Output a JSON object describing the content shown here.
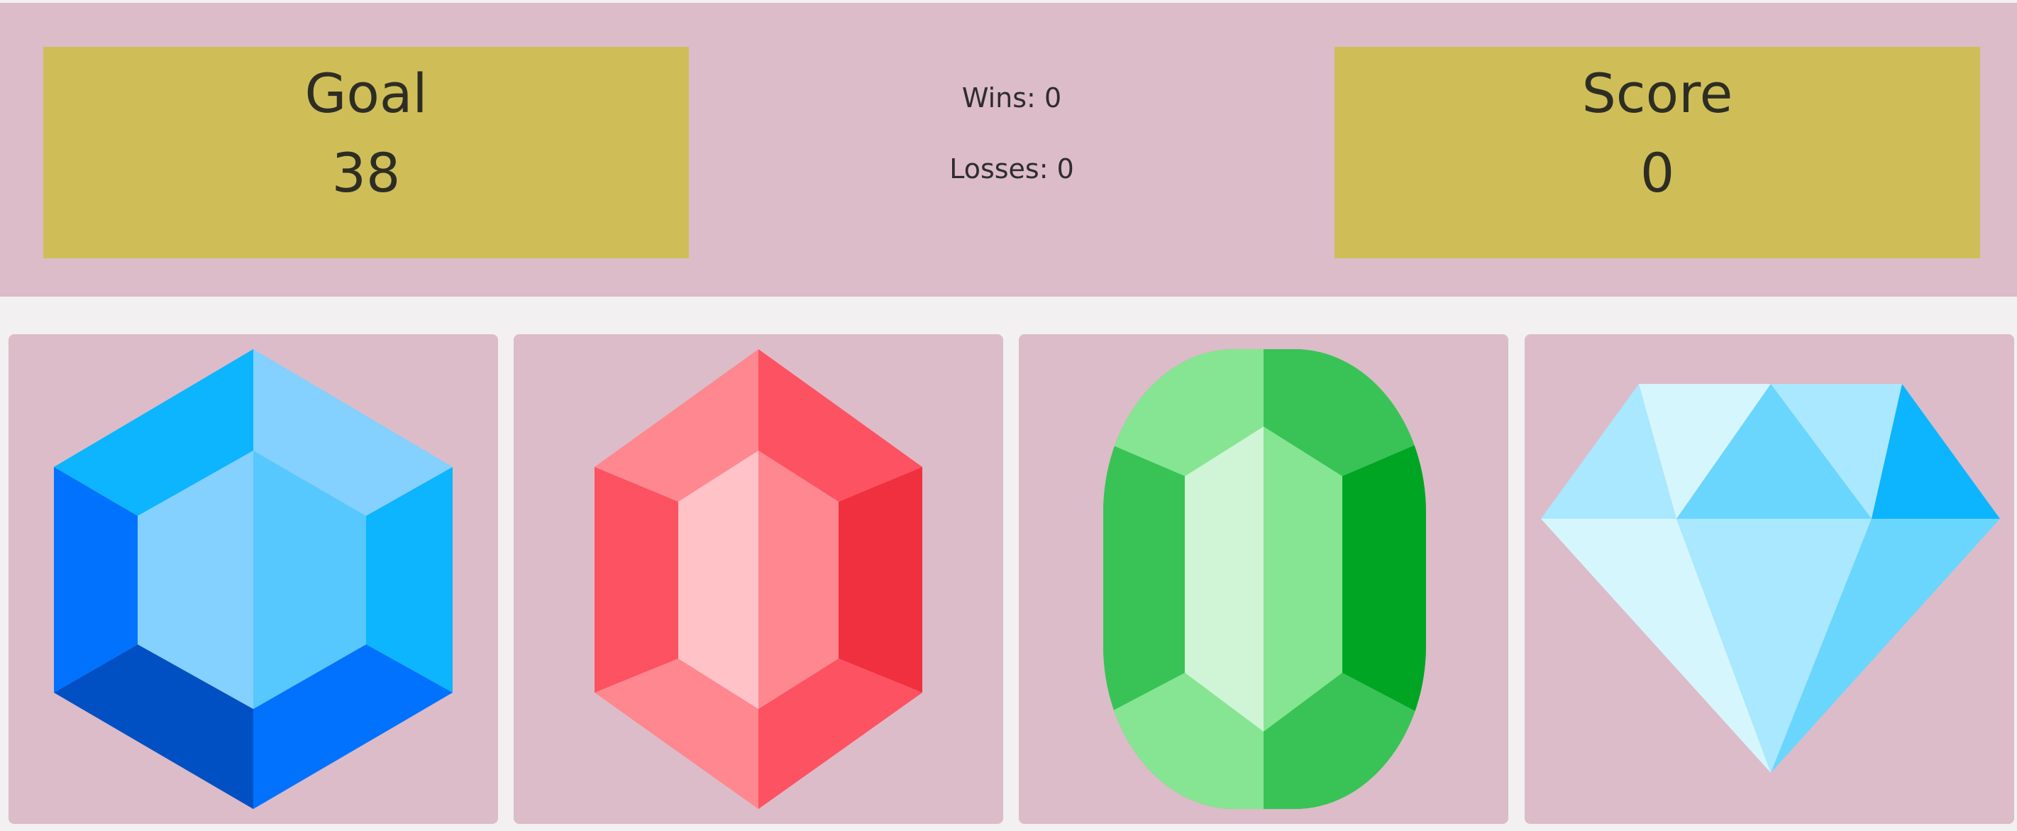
{
  "scoreboard": {
    "goal": {
      "label": "Goal",
      "value": "38"
    },
    "score": {
      "label": "Score",
      "value": "0"
    },
    "wins": {
      "label": "Wins:",
      "value": "0"
    },
    "losses": {
      "label": "Losses:",
      "value": "0"
    }
  },
  "gems": [
    {
      "icon": "blue-hexagon-gem-icon",
      "color": "#0a88f5"
    },
    {
      "icon": "red-hexagon-gem-icon",
      "color": "#fd5261"
    },
    {
      "icon": "green-oval-gem-icon",
      "color": "#39c356"
    },
    {
      "icon": "light-blue-diamond-icon",
      "color": "#6ad6fd"
    }
  ],
  "colors": {
    "panel_background": "#dcbcc8",
    "box_background": "#cfbe58",
    "page_background": "#f1efef",
    "text": "#2d2d24"
  }
}
